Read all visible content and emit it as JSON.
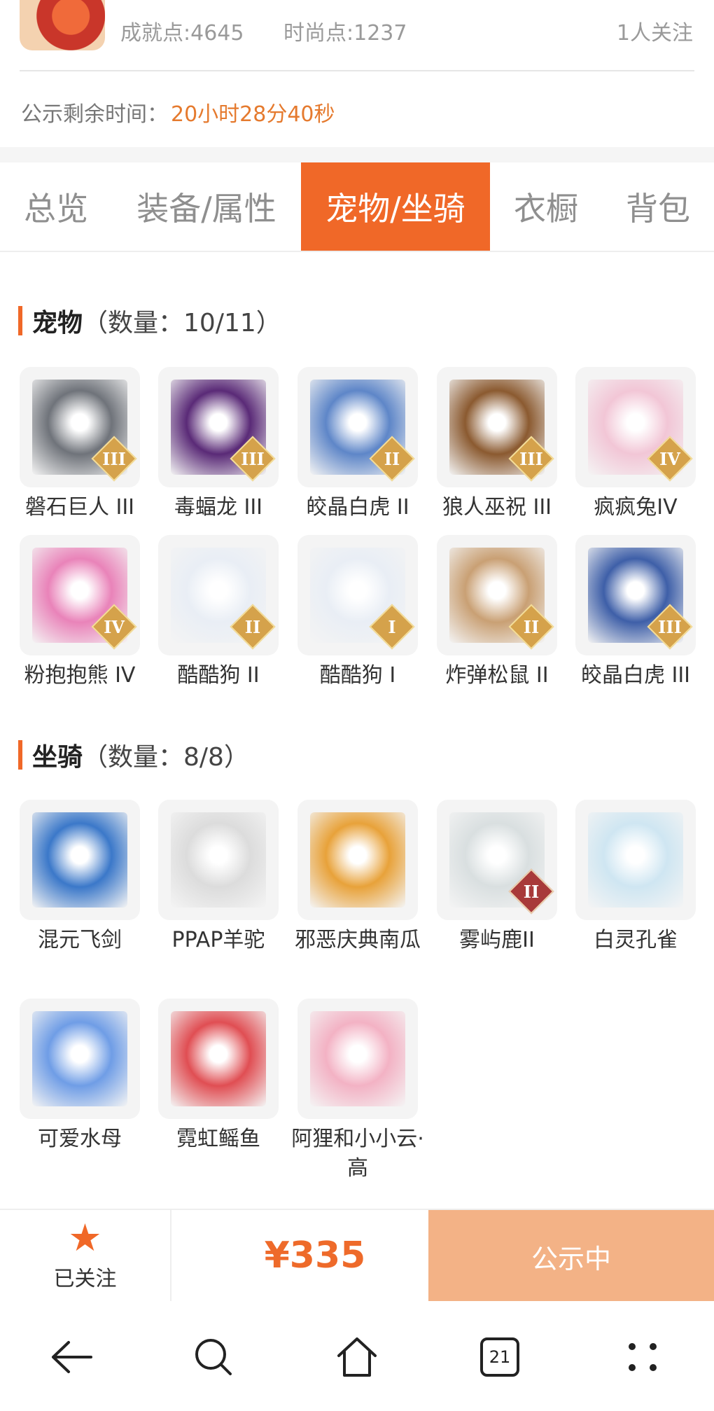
{
  "header": {
    "achievement": "成就点:4645",
    "fashion": "时尚点:1237",
    "followers": "1人关注",
    "notice_label": "公示剩余时间：",
    "notice_time": "20小时28分40秒"
  },
  "tabs": [
    "总览",
    "装备/属性",
    "宠物/坐骑",
    "衣橱",
    "背包"
  ],
  "active_tab": "宠物/坐骑",
  "pets": {
    "title": "宠物",
    "count": "（数量：10/11）",
    "items": [
      {
        "name": "磐石巨人 III",
        "rank": "III",
        "color": "#6f737a"
      },
      {
        "name": "毒蝠龙 III",
        "rank": "III",
        "color": "#5a2a77"
      },
      {
        "name": "皎晶白虎 II",
        "rank": "II",
        "color": "#5e86c8"
      },
      {
        "name": "狼人巫祝 III",
        "rank": "III",
        "color": "#8b5a30"
      },
      {
        "name": "疯疯兔IV",
        "rank": "IV",
        "color": "#f2c6d6"
      },
      {
        "name": "粉抱抱熊 IV",
        "rank": "IV",
        "color": "#e983b9"
      },
      {
        "name": "酷酷狗 II",
        "rank": "II",
        "color": "#e9eef5"
      },
      {
        "name": "酷酷狗 I",
        "rank": "I",
        "color": "#e9eef5"
      },
      {
        "name": "炸弹松鼠 II",
        "rank": "II",
        "color": "#c9a074"
      },
      {
        "name": "皎晶白虎 III",
        "rank": "III",
        "color": "#3e5fa8"
      }
    ]
  },
  "mounts": {
    "title": "坐骑",
    "count": "（数量：8/8）",
    "items": [
      {
        "name": "混元飞剑",
        "rank": "",
        "color": "#3b78c9"
      },
      {
        "name": "PPAP羊驼",
        "rank": "",
        "color": "#dcdcdc"
      },
      {
        "name": "邪恶庆典南瓜",
        "rank": "",
        "color": "#e8a23a"
      },
      {
        "name": "雾屿鹿II",
        "rank": "II",
        "color": "#d9dfe0"
      },
      {
        "name": "白灵孔雀",
        "rank": "",
        "color": "#cfe6f2"
      },
      {
        "name": "可爱水母",
        "rank": "",
        "color": "#6f9de6"
      },
      {
        "name": "霓虹鳐鱼",
        "rank": "",
        "color": "#e04e53"
      },
      {
        "name": "阿狸和小小云·高",
        "rank": "",
        "color": "#f3b2c4"
      }
    ]
  },
  "action_bar": {
    "follow_label": "已关注",
    "price": "¥335",
    "status_button": "公示中"
  },
  "system_nav": {
    "tab_count": "21"
  },
  "colors": {
    "accent": "#f06828",
    "price": "#ee6a2a",
    "status_button": "#f3b286"
  }
}
